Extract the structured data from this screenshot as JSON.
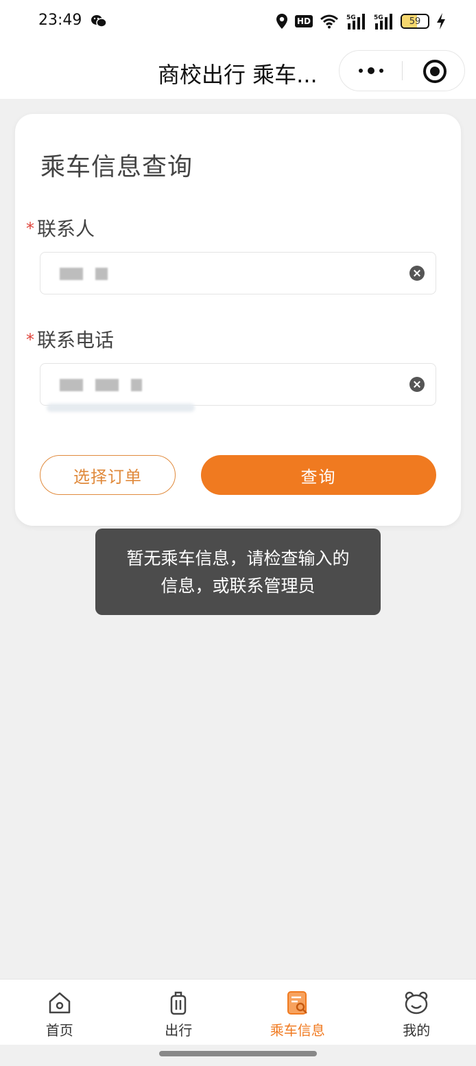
{
  "status_bar": {
    "time": "23:49",
    "hd_label": "HD",
    "signal_labels": [
      "5G",
      "5G"
    ],
    "battery_level": "59",
    "icons": [
      "wechat-icon",
      "location-icon",
      "hd-icon",
      "wifi-icon",
      "signal-icon",
      "battery-icon",
      "charging-icon"
    ]
  },
  "nav": {
    "title": "商校出行 乘车...",
    "more_icon": "more-dots-icon",
    "close_icon": "miniprogram-close-icon"
  },
  "form": {
    "title": "乘车信息查询",
    "required_mark": "*",
    "contact_label": "联系人",
    "phone_label": "联系电话",
    "contact_value": "",
    "phone_value": "",
    "clear_icon": "clear-icon"
  },
  "buttons": {
    "select_order": "选择订单",
    "query": "查询"
  },
  "toast": {
    "message": "暂无乘车信息，请检查输入的信息，或联系管理员"
  },
  "tab_bar": {
    "items": [
      {
        "label": "首页",
        "icon": "home-icon",
        "active": false
      },
      {
        "label": "出行",
        "icon": "luggage-icon",
        "active": false
      },
      {
        "label": "乘车信息",
        "icon": "ticket-search-icon",
        "active": true
      },
      {
        "label": "我的",
        "icon": "bear-face-icon",
        "active": false
      }
    ]
  },
  "colors": {
    "accent": "#f07a20",
    "outline_accent": "#e08a3c",
    "required": "#e0453c",
    "toast_bg": "#4c4c4c",
    "page_bg": "#f0f0f0"
  }
}
